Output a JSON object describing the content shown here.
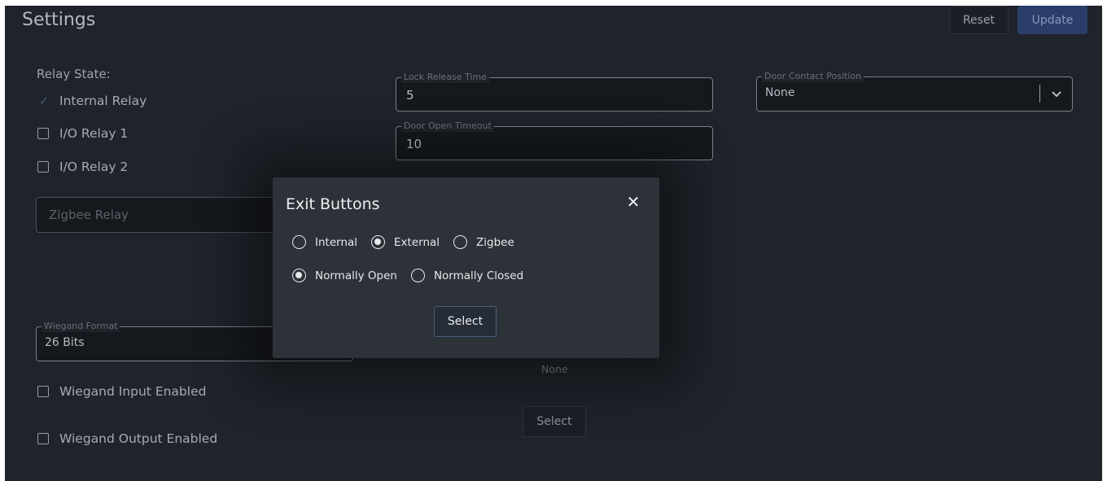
{
  "header": {
    "title": "Settings",
    "reset_label": "Reset",
    "update_label": "Update"
  },
  "relay": {
    "label": "Relay State:",
    "options": [
      {
        "label": "Internal Relay",
        "checked": true
      },
      {
        "label": "I/O Relay 1",
        "checked": false
      },
      {
        "label": "I/O Relay 2",
        "checked": false
      }
    ],
    "zigbee_placeholder": "Zigbee Relay"
  },
  "lock_release": {
    "legend": "Lock Release Time",
    "value": "5"
  },
  "door_open": {
    "legend": "Door Open Timeout",
    "value": "10"
  },
  "door_contact": {
    "legend": "Door Contact Position",
    "value": "None"
  },
  "wiegand": {
    "legend": "Wiegand Format",
    "value": "26 Bits",
    "input_label": "Wiegand Input Enabled",
    "output_label": "Wiegand Output Enabled"
  },
  "behind": {
    "none_text": "None",
    "select_label": "Select"
  },
  "modal": {
    "title": "Exit Buttons",
    "close_glyph": "✕",
    "source_options": [
      {
        "label": "Internal",
        "selected": false
      },
      {
        "label": "External",
        "selected": true
      },
      {
        "label": "Zigbee",
        "selected": false
      }
    ],
    "mode_options": [
      {
        "label": "Normally Open",
        "selected": true
      },
      {
        "label": "Normally Closed",
        "selected": false
      }
    ],
    "select_label": "Select"
  }
}
